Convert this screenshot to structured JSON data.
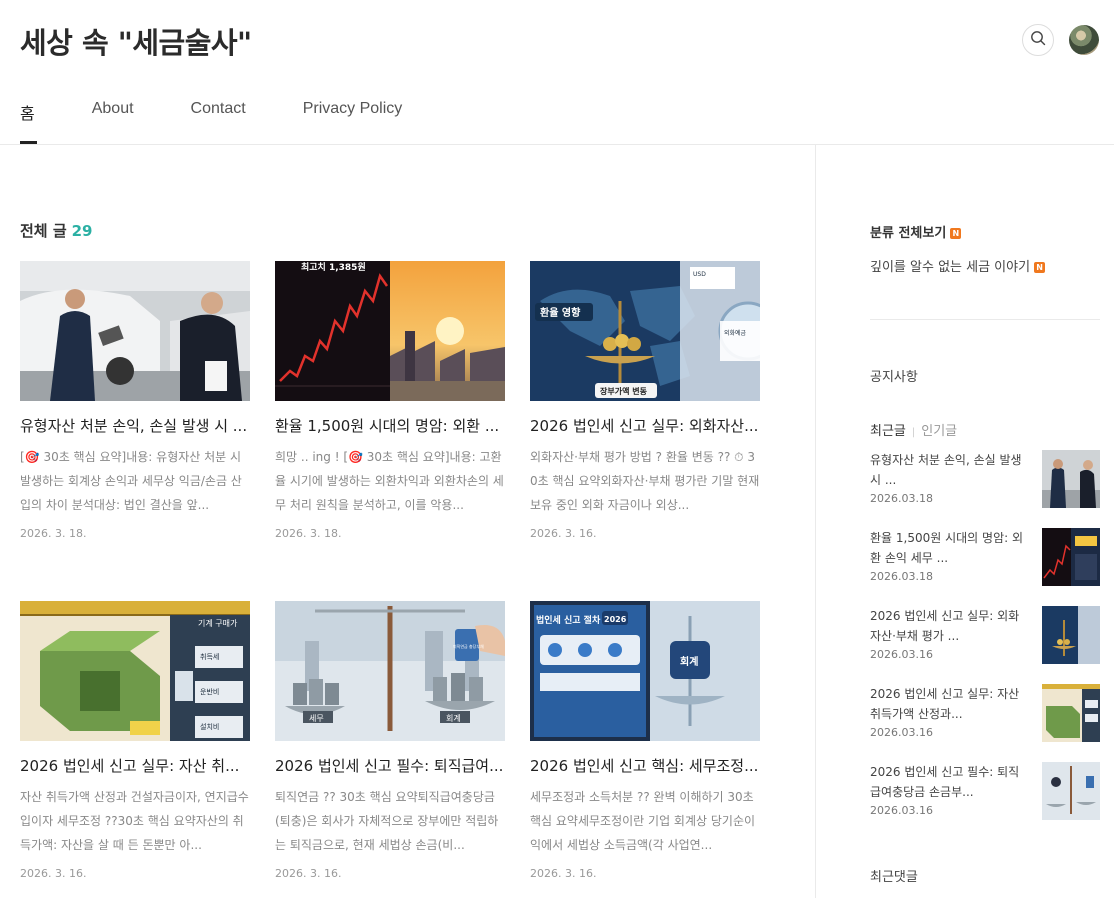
{
  "site": {
    "title": "세상 속 \"세금술사\""
  },
  "header": {
    "search_icon": "search-icon",
    "avatar_icon": "profile-avatar"
  },
  "nav": [
    {
      "label": "홈",
      "active": true
    },
    {
      "label": "About",
      "active": false
    },
    {
      "label": "Contact",
      "active": false
    },
    {
      "label": "Privacy Policy",
      "active": false
    }
  ],
  "list": {
    "heading": "전체 글",
    "count": "29"
  },
  "posts": [
    {
      "title": "유형자산 처분 손익, 손실 발생 시 ...",
      "summary": "[🎯 30초 핵심 요약]내용: 유형자산 처분 시 발생하는 회계상 손익과 세무상 익금/손금 산입의 차이 분석대상: 법인 결산을 앞...",
      "date": "2026. 3. 18."
    },
    {
      "title": "환율 1,500원 시대의 명암: 외환 ...",
      "summary": "희망 .. ing ! [🎯 30초 핵심 요약]내용: 고환율 시기에 발생하는 외환차익과 외환차손의 세무 처리 원칙을 분석하고, 이를 악용...",
      "date": "2026. 3. 18.",
      "thumb_text": "최고치 1,385원"
    },
    {
      "title": "2026 법인세 신고 실무: 외화자산...",
      "summary": "외화자산·부채 평가 방법 ? 환율 변동 ?? ⏱ 30초 핵심 요약외화자산·부채 평가란 기말 현재 보유 중인 외화 자금이나 외상...",
      "date": "2026. 3. 16.",
      "thumb_text": [
        "환율 영향",
        "장부가액 변동",
        "USD",
        "외화예금"
      ]
    },
    {
      "title": "2026 법인세 신고 실무: 자산 취...",
      "summary": "자산 취득가액 산정과 건설자금이자, 연지급수입이자 세무조정 ??30초 핵심 요약자산의 취득가액: 자산을 살 때 든 돈뿐만 아...",
      "date": "2026. 3. 16.",
      "thumb_text": [
        "기계 구매가",
        "취득세",
        "운반비",
        "설치비"
      ]
    },
    {
      "title": "2026 법인세 신고 필수: 퇴직급여...",
      "summary": "퇴직연금 ?? 30초 핵심 요약퇴직급여충당금(퇴충)은 회사가 자체적으로 장부에만 적립하는 퇴직금으로, 현재 세법상 손금(비...",
      "date": "2026. 3. 16.",
      "thumb_text": [
        "세무",
        "회계",
        "퇴직연금 충당부채"
      ]
    },
    {
      "title": "2026 법인세 신고 핵심: 세무조정...",
      "summary": "세무조정과 소득처분 ?? 완벽 이해하기 30초 핵심 요약세무조정이란 기업 회계상 당기순이익에서 세법상 소득금액(각 사업연...",
      "date": "2026. 3. 16.",
      "thumb_text": [
        "법인세 신고 절차",
        "2026",
        "회계"
      ]
    }
  ],
  "sidebar": {
    "category_title": "분류 전체보기",
    "category_item": "깊이를 알수 없는 세금 이야기",
    "new_badge": "N",
    "notice_title": "공지사항",
    "tab_recent": "최근글",
    "tab_popular": "인기글",
    "recent_posts": [
      {
        "title": "유형자산 처분 손익, 손실 발생 시 ...",
        "date": "2026.03.18"
      },
      {
        "title": "환율 1,500원 시대의 명암: 외환 손익 세무 ...",
        "date": "2026.03.18"
      },
      {
        "title": "2026 법인세 신고 실무: 외화자산·부채 평가 ...",
        "date": "2026.03.16"
      },
      {
        "title": "2026 법인세 신고 실무: 자산 취득가액 산정과...",
        "date": "2026.03.16"
      },
      {
        "title": "2026 법인세 신고 필수: 퇴직급여충당금 손금부...",
        "date": "2026.03.16"
      }
    ],
    "comments_title": "최근댓글"
  }
}
